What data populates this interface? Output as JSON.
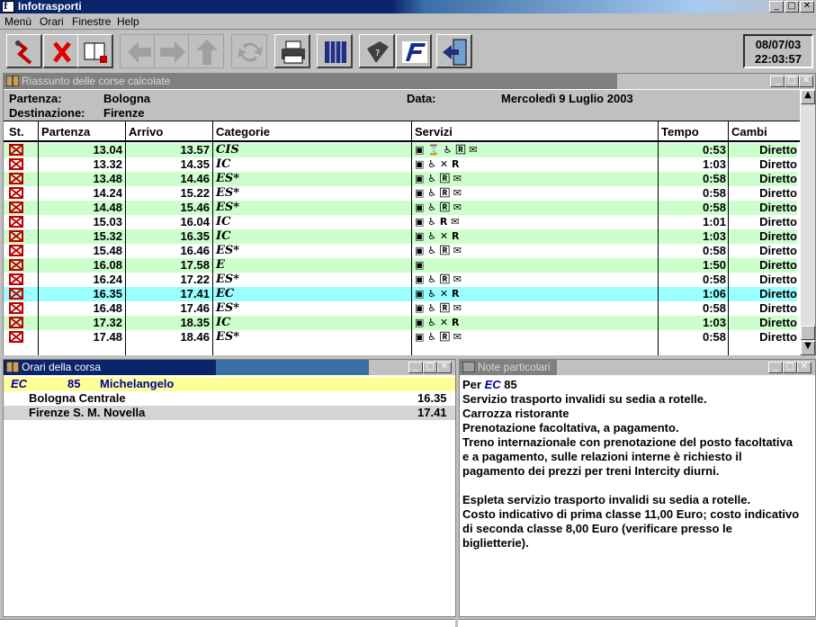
{
  "app": {
    "title": "Infotrasporti"
  },
  "menu": [
    "Menù",
    "Orari",
    "Finestre",
    "Help"
  ],
  "toolbar": {
    "date": "08/07/03",
    "time": "22:03:57",
    "buttons": [
      "route-icon",
      "cancel-icon",
      "book-icon",
      "back-arrow-icon",
      "forward-arrow-icon",
      "up-arrow-icon",
      "refresh-icon",
      "printer-icon",
      "timetable-icon",
      "help-book-icon",
      "fs-logo-icon",
      "exit-door-icon"
    ]
  },
  "summary": {
    "title": "Riassunto delle corse calcolate",
    "partenza_label": "Partenza:",
    "partenza_value": "Bologna",
    "destinazione_label": "Destinazione:",
    "destinazione_value": "Firenze",
    "data_label": "Data:",
    "data_value": "Mercoledì 9 Luglio 2003",
    "columns": [
      "St.",
      "Partenza",
      "Arrivo",
      "Categorie",
      "Servizi",
      "Tempo",
      "Cambi"
    ],
    "rows": [
      {
        "dep": "13.04",
        "arr": "13.57",
        "cat": "CIS",
        "serv": "▣ ⌛ ♿ 🅁 ✉",
        "tempo": "0:53",
        "cambi": "Diretto",
        "selected": false
      },
      {
        "dep": "13.32",
        "arr": "14.35",
        "cat": "IC",
        "serv": "▣ ♿ ✕ R",
        "tempo": "1:03",
        "cambi": "Diretto",
        "selected": false
      },
      {
        "dep": "13.48",
        "arr": "14.46",
        "cat": "ES*",
        "serv": "▣ ♿ 🅁 ✉",
        "tempo": "0:58",
        "cambi": "Diretto",
        "selected": false
      },
      {
        "dep": "14.24",
        "arr": "15.22",
        "cat": "ES*",
        "serv": "▣ ♿ 🅁 ✉",
        "tempo": "0:58",
        "cambi": "Diretto",
        "selected": false
      },
      {
        "dep": "14.48",
        "arr": "15.46",
        "cat": "ES*",
        "serv": "▣ ♿ 🅁 ✉",
        "tempo": "0:58",
        "cambi": "Diretto",
        "selected": false
      },
      {
        "dep": "15.03",
        "arr": "16.04",
        "cat": "IC",
        "serv": "▣ ♿ R ✉",
        "tempo": "1:01",
        "cambi": "Diretto",
        "selected": false
      },
      {
        "dep": "15.32",
        "arr": "16.35",
        "cat": "IC",
        "serv": "▣ ♿ ✕ R",
        "tempo": "1:03",
        "cambi": "Diretto",
        "selected": false
      },
      {
        "dep": "15.48",
        "arr": "16.46",
        "cat": "ES*",
        "serv": "▣ ♿ 🅁 ✉",
        "tempo": "0:58",
        "cambi": "Diretto",
        "selected": false
      },
      {
        "dep": "16.08",
        "arr": "17.58",
        "cat": "E",
        "serv": "▣",
        "tempo": "1:50",
        "cambi": "Diretto",
        "selected": false
      },
      {
        "dep": "16.24",
        "arr": "17.22",
        "cat": "ES*",
        "serv": "▣ ♿ 🅁 ✉",
        "tempo": "0:58",
        "cambi": "Diretto",
        "selected": false
      },
      {
        "dep": "16.35",
        "arr": "17.41",
        "cat": "EC",
        "serv": "▣ ♿ ✕ R",
        "tempo": "1:06",
        "cambi": "Diretto",
        "selected": true
      },
      {
        "dep": "16.48",
        "arr": "17.46",
        "cat": "ES*",
        "serv": "▣ ♿ 🅁 ✉",
        "tempo": "0:58",
        "cambi": "Diretto",
        "selected": false
      },
      {
        "dep": "17.32",
        "arr": "18.35",
        "cat": "IC",
        "serv": "▣ ♿ ✕ R",
        "tempo": "1:03",
        "cambi": "Diretto",
        "selected": false
      },
      {
        "dep": "17.48",
        "arr": "18.46",
        "cat": "ES*",
        "serv": "▣ ♿ 🅁 ✉",
        "tempo": "0:58",
        "cambi": "Diretto",
        "selected": false
      }
    ]
  },
  "orari": {
    "title": "Orari della corsa",
    "train_cat": "EC",
    "train_number": "85",
    "train_name": "Michelangelo",
    "stops": [
      {
        "name": "Bologna Centrale",
        "time": "16.35"
      },
      {
        "name": "Firenze S. M. Novella",
        "time": "17.41"
      }
    ]
  },
  "note": {
    "title": "Note particolari",
    "per_label": "Per",
    "per_cat": "EC",
    "per_number": "85",
    "lines": [
      "Servizio trasporto invalidi su sedia a rotelle.",
      "Carrozza ristorante",
      "Prenotazione facoltativa, a pagamento.",
      "Treno internazionale con prenotazione del posto facoltativa",
      "e a pagamento, sulle relazioni interne è richiesto il",
      "pagamento dei prezzi per treni Intercity diurni.",
      "",
      "Espleta servizio trasporto invalidi su sedia a rotelle.",
      "Costo indicativo di prima classe 11,00 Euro; costo indicativo",
      "di seconda classe 8,00 Euro (verificare presso le",
      "biglietterie)."
    ]
  },
  "colors": {
    "row_green": "#ccffcc",
    "row_selected": "#99ffff",
    "train_highlight": "#ffff99",
    "title_active": "#0a246a",
    "title_inactive": "#808080"
  }
}
